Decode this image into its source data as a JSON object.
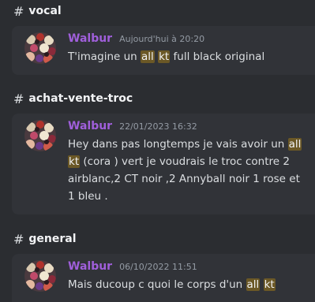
{
  "results": [
    {
      "channel": "vocal",
      "username": "Walbur",
      "timestamp": "Aujourd'hui à 20:20",
      "segments": [
        {
          "text": "T'imagine un "
        },
        {
          "text": "all",
          "hl": true
        },
        {
          "text": " "
        },
        {
          "text": "kt",
          "hl": true
        },
        {
          "text": " full black original"
        }
      ]
    },
    {
      "channel": "achat-vente-troc",
      "username": "Walbur",
      "timestamp": "22/01/2023 16:32",
      "segments": [
        {
          "text": "Hey dans pas longtemps je vais avoir un "
        },
        {
          "text": "all",
          "hl": true
        },
        {
          "text": " "
        },
        {
          "text": "kt",
          "hl": true
        },
        {
          "text": " (cora ) vert je voudrais le troc contre 2 airblanc,2 CT noir ,2 Annyball noir 1 rose et 1 bleu ."
        }
      ]
    },
    {
      "channel": "general",
      "username": "Walbur",
      "timestamp": "06/10/2022 11:51",
      "segments": [
        {
          "text": "Mais ducoup c quoi le corps d'un "
        },
        {
          "text": "all",
          "hl": true
        },
        {
          "text": " "
        },
        {
          "text": "kt",
          "hl": true
        }
      ]
    }
  ],
  "colors": {
    "background": "#2b2d31",
    "card": "#313338",
    "username": "#a05fdb",
    "timestamp": "#949ba4",
    "highlight": "#6b5826"
  },
  "icons": {
    "channel": "hash-icon",
    "avatar": "avatar-image"
  }
}
